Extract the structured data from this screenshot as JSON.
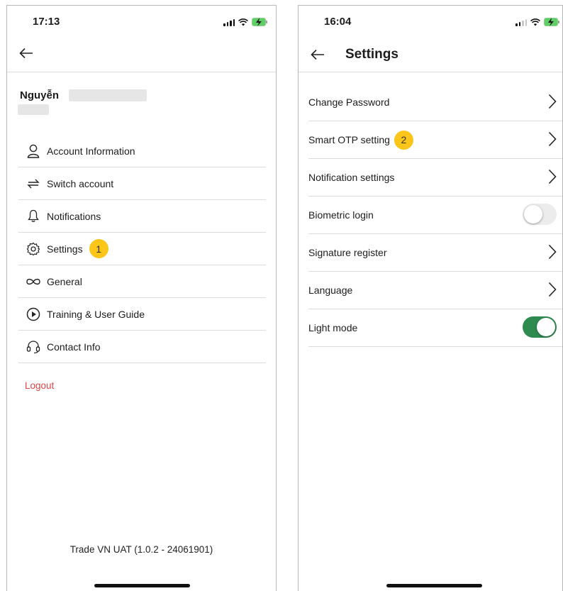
{
  "left_screen": {
    "status": {
      "time": "17:13"
    },
    "user": {
      "name": "Nguyễn"
    },
    "menu": [
      {
        "label": "Account Information",
        "icon": "user-icon"
      },
      {
        "label": "Switch account",
        "icon": "switch-icon"
      },
      {
        "label": "Notifications",
        "icon": "bell-icon"
      },
      {
        "label": "Settings",
        "icon": "gear-icon",
        "step": "1"
      },
      {
        "label": "General",
        "icon": "infinity-icon"
      },
      {
        "label": "Training & User Guide",
        "icon": "play-circle-icon"
      },
      {
        "label": "Contact Info",
        "icon": "headset-icon"
      }
    ],
    "logout_label": "Logout",
    "version": "Trade VN UAT (1.0.2 - 24061901)"
  },
  "right_screen": {
    "status": {
      "time": "16:04"
    },
    "title": "Settings",
    "items": [
      {
        "label": "Change Password",
        "control": "chevron"
      },
      {
        "label": "Smart OTP setting",
        "control": "chevron",
        "step": "2"
      },
      {
        "label": "Notification settings",
        "control": "chevron"
      },
      {
        "label": "Biometric login",
        "control": "toggle",
        "on": false
      },
      {
        "label": "Signature register",
        "control": "chevron"
      },
      {
        "label": "Language",
        "control": "chevron"
      },
      {
        "label": "Light mode",
        "control": "toggle",
        "on": true
      }
    ]
  },
  "colors": {
    "step_badge": "#fbc51a",
    "logout": "#e04545",
    "toggle_on": "#2e8b4f",
    "toggle_off": "#ececec"
  }
}
